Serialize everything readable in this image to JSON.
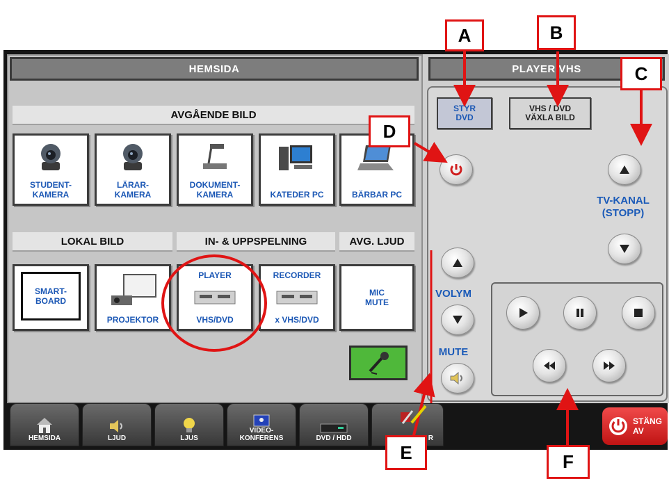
{
  "left_panel": {
    "title": "HEMSIDA",
    "sections": {
      "outgoing": "AVGÅENDE BILD",
      "local": "LOKAL BILD",
      "playback": "IN- & UPPSPELNING",
      "audio": "AVG. LJUD"
    },
    "outgoing_tiles": [
      {
        "line1": "STUDENT-",
        "line2": "KAMERA",
        "icon": "camera-icon"
      },
      {
        "line1": "LÄRAR-",
        "line2": "KAMERA",
        "icon": "camera-icon"
      },
      {
        "line1": "DOKUMENT-",
        "line2": "KAMERA",
        "icon": "document-camera-icon"
      },
      {
        "line1": "KATEDER PC",
        "line2": "",
        "icon": "desktop-pc-icon"
      },
      {
        "line1": "BÄRBAR PC",
        "line2": "",
        "icon": "laptop-icon"
      }
    ],
    "local_tiles": {
      "smartboard": {
        "line1": "SMART-",
        "line2": "BOARD"
      },
      "projector": {
        "label": "PROJEKTOR"
      },
      "player": {
        "line1": "PLAYER",
        "line2": "VHS/DVD"
      },
      "recorder": {
        "line1": "RECORDER",
        "line2": "x VHS/DVD"
      },
      "mic": {
        "line1": "MIC",
        "line2": "MUTE"
      }
    }
  },
  "right_panel": {
    "title": "PLAYER VHS",
    "styr_dvd": {
      "line1": "STYR",
      "line2": "DVD"
    },
    "switch": {
      "line1": "VHS / DVD",
      "line2": "VÄXLA BILD"
    },
    "tv_kanal": {
      "line1": "TV-KANAL",
      "line2": "(STOPP)"
    },
    "volym": "VOLYM",
    "mute": "MUTE"
  },
  "bottom_tabs": [
    {
      "label": "HEMSIDA",
      "icon": "house-icon"
    },
    {
      "label": "LJUD",
      "icon": "speaker-icon"
    },
    {
      "label": "LJUS",
      "icon": "light-bulb-icon"
    },
    {
      "label": "VIDEO-",
      "label2": "KONFERENS",
      "icon": "video-conference-icon"
    },
    {
      "label": "DVD / HDD",
      "icon": "dvd-recorder-icon"
    },
    {
      "label": "R",
      "icon": "tools-icon"
    }
  ],
  "power_off": {
    "line1": "STÄNG",
    "line2": "AV"
  },
  "callouts": [
    "A",
    "B",
    "C",
    "D",
    "E",
    "F"
  ],
  "colors": {
    "accent_blue": "#1c58b5",
    "annotation_red": "#e01414",
    "power_red": "#e02020",
    "mic_green": "#4fb83a"
  }
}
